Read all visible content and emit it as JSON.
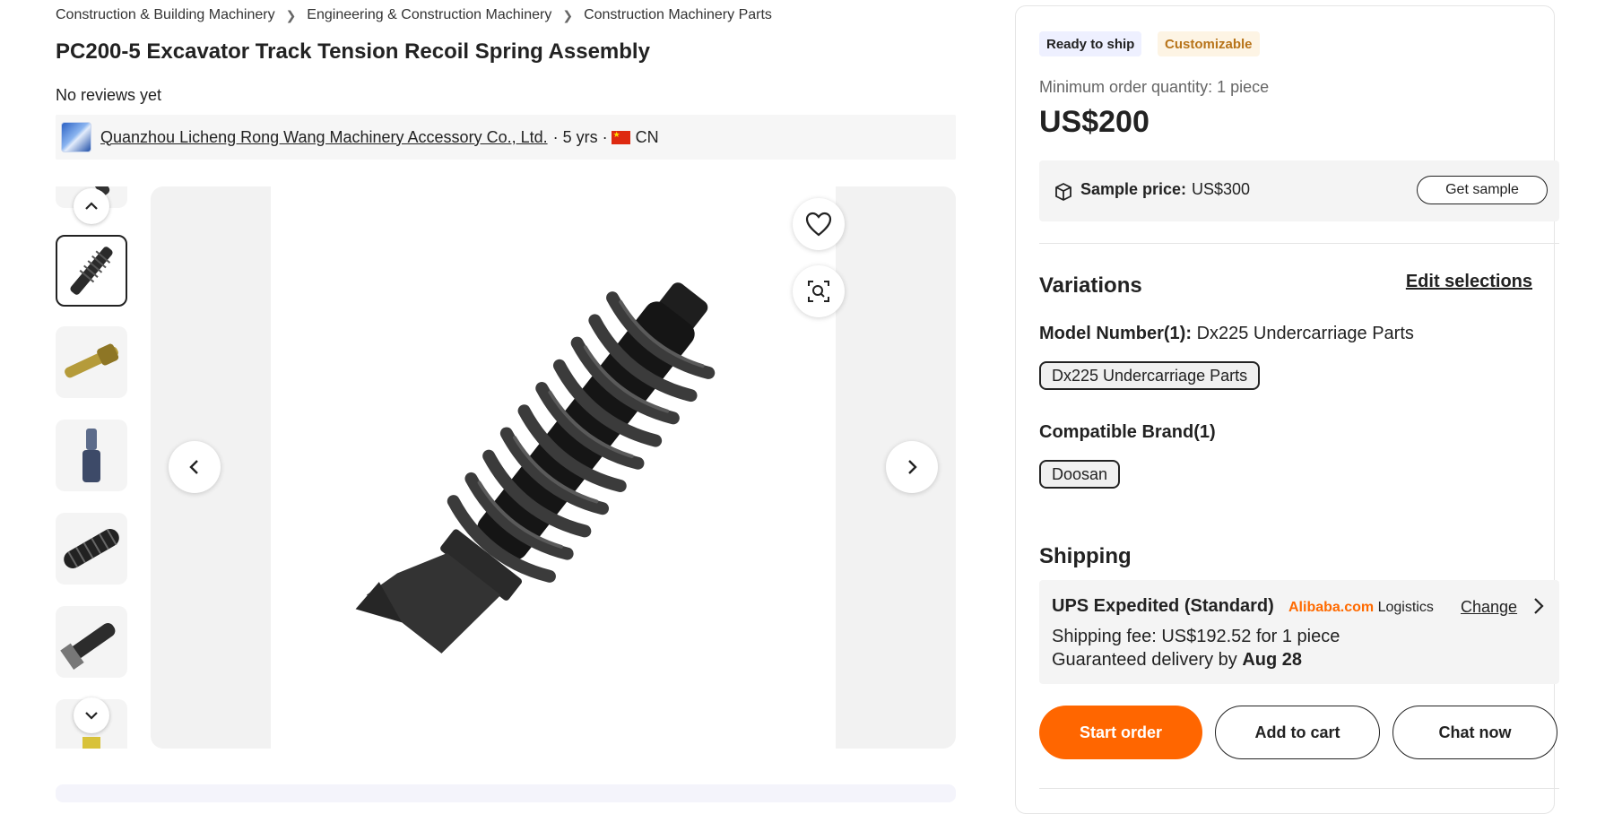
{
  "breadcrumb": {
    "items": [
      "Construction & Building Machinery",
      "Engineering & Construction Machinery",
      "Construction Machinery Parts"
    ]
  },
  "product": {
    "title": "PC200-5 Excavator Track Tension Recoil Spring Assembly",
    "reviews": "No reviews yet"
  },
  "supplier": {
    "name": "Quanzhou Licheng Rong Wang Machinery Accessory Co., Ltd.",
    "years": "· 5 yrs ·",
    "country": "CN"
  },
  "gallery": {
    "thumbnail_count": 7,
    "selected_index": 1
  },
  "panel": {
    "tags": {
      "ready": "Ready to ship",
      "custom": "Customizable"
    },
    "moq": "Minimum order quantity: 1 piece",
    "price": "US$200",
    "sample": {
      "label": "Sample price:",
      "value": "US$300",
      "button": "Get sample"
    },
    "variations": {
      "title": "Variations",
      "edit": "Edit selections",
      "model_label": "Model Number(1):",
      "model_value": "Dx225 Undercarriage Parts",
      "model_option": "Dx225 Undercarriage Parts",
      "brand_label": "Compatible Brand(1)",
      "brand_option": "Doosan"
    },
    "shipping": {
      "title": "Shipping",
      "method": "UPS Expedited (Standard)",
      "logistics_brand": "Alibaba.com",
      "logistics_word": "Logistics",
      "change": "Change",
      "fee": "Shipping fee: US$192.52 for 1 piece",
      "guarantee_prefix": "Guaranteed delivery by",
      "guarantee_date": "Aug 28"
    },
    "actions": {
      "start": "Start order",
      "cart": "Add to cart",
      "chat": "Chat now"
    }
  },
  "colors": {
    "accent": "#ff6600",
    "tag_custom": "#b8741a",
    "logistics_brand": "#ff6a00"
  }
}
